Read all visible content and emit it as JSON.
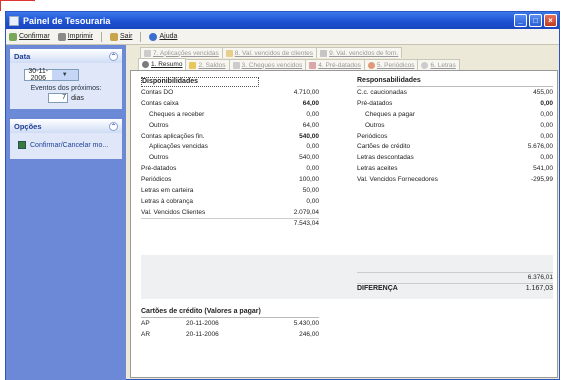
{
  "window": {
    "title": "Painel de Tesouraria",
    "controls": [
      "_",
      "□",
      "×"
    ]
  },
  "menubar": [
    {
      "label": "Confirmar",
      "icon": "check-icon"
    },
    {
      "label": "Imprimir",
      "icon": "printer-icon"
    },
    {
      "label": "Sair",
      "icon": "exit-icon"
    },
    {
      "label": "Ajuda",
      "icon": "help-icon"
    }
  ],
  "sidebar": {
    "data_panel": {
      "title": "Data",
      "date": "30-11-2006",
      "eventos_label": "Eventos dos próximos:",
      "dias_value": "7",
      "dias_label": "dias"
    },
    "opcoes_panel": {
      "title": "Opções",
      "item": "Confirmar/Cancelar mo..."
    }
  },
  "tabs_top": [
    {
      "label": "7. Aplicações vencidas"
    },
    {
      "label": "8. Val. vencidos de clientes"
    },
    {
      "label": "9. Val. vencidos de forn."
    }
  ],
  "tabs_bottom": [
    {
      "label": "1. Resumo",
      "active": true
    },
    {
      "label": "2. Saldos"
    },
    {
      "label": "3. Cheques vencidos"
    },
    {
      "label": "4. Pré-datados"
    },
    {
      "label": "5. Periódicos"
    },
    {
      "label": "6. Letras"
    }
  ],
  "disponibilidades": {
    "title": "Disponibilidades",
    "rows": [
      {
        "label": "Contas DO",
        "value": "4.710,00"
      },
      {
        "label": "Contas caixa",
        "value": "64,00",
        "bold": true
      },
      {
        "label": "Cheques a receber",
        "value": "0,00",
        "indent": true
      },
      {
        "label": "Outros",
        "value": "64,00",
        "indent": true
      },
      {
        "label": "Contas aplicações fin.",
        "value": "540,00",
        "bold": true
      },
      {
        "label": "Aplicações vencidas",
        "value": "0,00",
        "indent": true
      },
      {
        "label": "Outros",
        "value": "540,00",
        "indent": true
      },
      {
        "label": "Pré-datados",
        "value": "0,00"
      },
      {
        "label": "Periódicos",
        "value": "100,00"
      },
      {
        "label": "Letras em carteira",
        "value": "50,00"
      },
      {
        "label": "Letras à cobrança",
        "value": "0,00"
      },
      {
        "label": "Val. Vencidos Clientes",
        "value": "2.079,04"
      }
    ],
    "total": "7.543,04"
  },
  "responsabilidades": {
    "title": "Responsabilidades",
    "rows": [
      {
        "label": "C.c. caucionadas",
        "value": "455,00"
      },
      {
        "label": "Pré-datados",
        "value": "0,00",
        "bold": true
      },
      {
        "label": "Cheques a pagar",
        "value": "0,00",
        "indent": true
      },
      {
        "label": "Outros",
        "value": "0,00",
        "indent": true
      },
      {
        "label": "Periódicos",
        "value": "0,00"
      },
      {
        "label": "Cartões de crédito",
        "value": "5.676,00"
      },
      {
        "label": "Letras descontadas",
        "value": "0,00"
      },
      {
        "label": "Letras aceites",
        "value": "541,00"
      },
      {
        "label": "Val. Vencidos Fornecedores",
        "value": "-295,99"
      }
    ],
    "total": "6.376,01",
    "diferenca_label": "DIFERENÇA",
    "diferenca_value": "1.167,03"
  },
  "cartoes": {
    "title": "Cartões de crédito (Valores a pagar)",
    "rows": [
      {
        "name": "AP",
        "date": "20-11-2006",
        "value": "5.430,00"
      },
      {
        "name": "AR",
        "date": "20-11-2006",
        "value": "246,00"
      }
    ]
  },
  "colors": {
    "title_blue": "#1d4fd1",
    "sidebar_blue": "#6b89d6",
    "panel_text": "#1f3f95"
  }
}
